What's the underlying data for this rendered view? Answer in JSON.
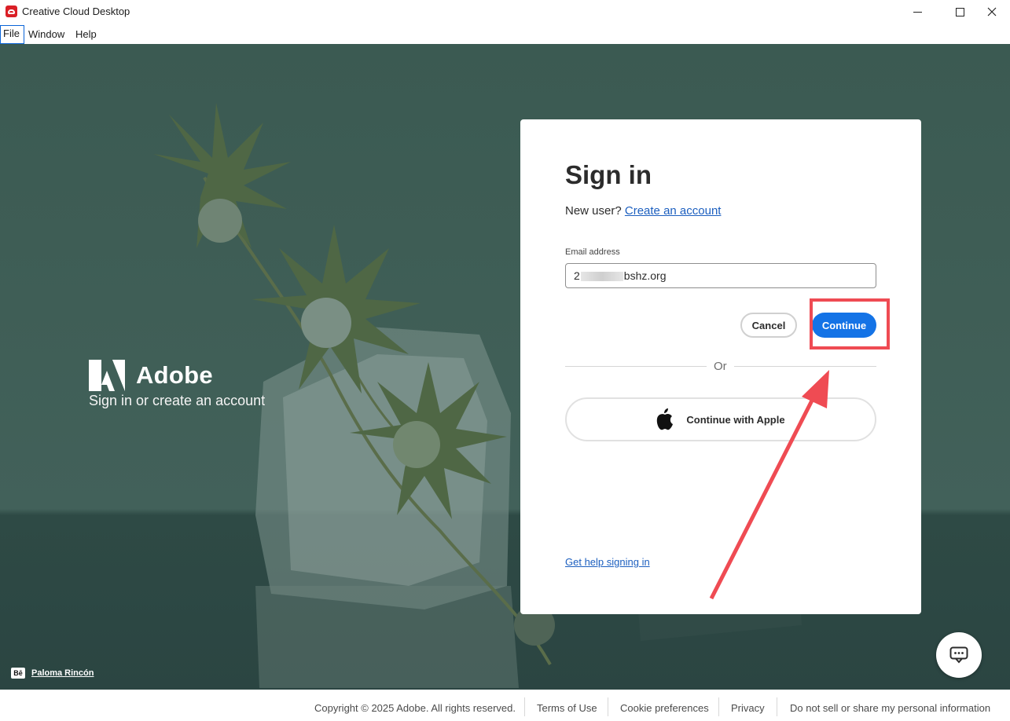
{
  "window": {
    "title": "Creative Cloud Desktop",
    "app_icon": "creative-cloud-icon"
  },
  "menu": {
    "items": [
      "File",
      "Window",
      "Help"
    ]
  },
  "brand": {
    "name": "Adobe",
    "tagline": "Sign in or create an account",
    "credit_icon": "Bē",
    "credit_name": "Paloma Rincón"
  },
  "signin": {
    "title": "Sign in",
    "new_user_text": "New user?",
    "create_account_link": "Create an account",
    "email_label": "Email address",
    "email_prefix": "2",
    "email_suffix": "bshz.org",
    "cancel_label": "Cancel",
    "continue_label": "Continue",
    "or_text": "Or",
    "apple_label": "Continue with Apple",
    "help_link": "Get help signing in"
  },
  "footer": {
    "copyright": "Copyright © 2025 Adobe. All rights reserved.",
    "terms": "Terms of Use",
    "cookies": "Cookie preferences",
    "privacy": "Privacy",
    "do_not_sell": "Do not sell or share my personal information"
  },
  "colors": {
    "accent": "#1473e6",
    "annotation": "#ef4b53",
    "background": "#3f5e56"
  }
}
